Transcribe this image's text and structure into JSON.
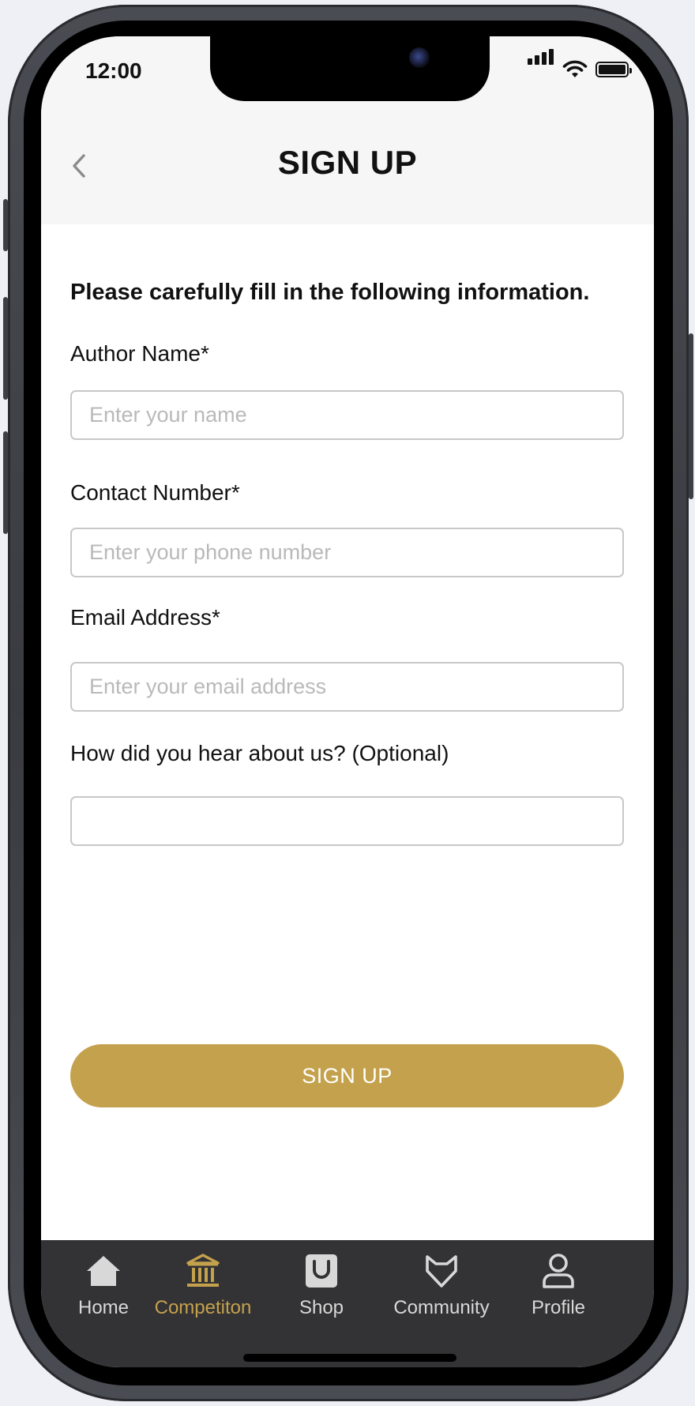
{
  "status": {
    "time": "12:00"
  },
  "header": {
    "title": "SIGN UP",
    "back_icon": "chevron-left-icon"
  },
  "form": {
    "intro": "Please carefully fill in the following information.",
    "fields": [
      {
        "label": "Author Name*",
        "placeholder": "Enter your name",
        "value": ""
      },
      {
        "label": "Contact Number*",
        "placeholder": "Enter your phone number",
        "value": ""
      },
      {
        "label": "Email Address*",
        "placeholder": "Enter your email address",
        "value": ""
      },
      {
        "label": "How did you hear about us? (Optional)",
        "placeholder": "",
        "value": ""
      }
    ],
    "submit_label": "SIGN UP"
  },
  "tabbar": {
    "items": [
      {
        "label": "Home",
        "icon": "home-icon",
        "active": false
      },
      {
        "label": "Competiton",
        "icon": "museum-icon",
        "active": true
      },
      {
        "label": "Shop",
        "icon": "shopping-bag-icon",
        "active": false
      },
      {
        "label": "Community",
        "icon": "cat-icon",
        "active": false
      },
      {
        "label": "Profile",
        "icon": "person-icon",
        "active": false
      }
    ]
  },
  "colors": {
    "accent": "#c4a14c",
    "tabbar_bg": "#333335",
    "header_bg": "#f6f6f6"
  }
}
